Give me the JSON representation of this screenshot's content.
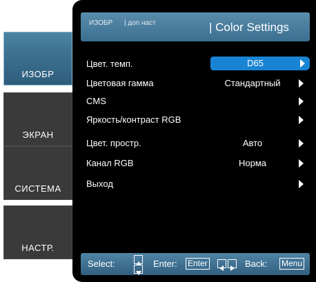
{
  "nav": {
    "items": [
      {
        "label": "ИЗОБР",
        "active": true
      },
      {
        "label": "ЭКРАН",
        "active": false
      },
      {
        "label": "СИСТЕМА",
        "active": false
      },
      {
        "label": "НАСТР.",
        "active": false
      }
    ]
  },
  "header": {
    "crumb1": "ИЗОБР",
    "crumb2": "| доп наст",
    "title": "| Color Settings"
  },
  "menu": {
    "rows": [
      {
        "label": "Цвет. темп.",
        "value": "D65",
        "selected": true,
        "arrow": true
      },
      {
        "label": "Цветовая гамма",
        "value": "Стандартный",
        "selected": false,
        "arrow": true
      },
      {
        "label": "CMS",
        "value": "",
        "selected": false,
        "arrow": true
      },
      {
        "label": "Яркость/контраст RGB",
        "value": "",
        "selected": false,
        "arrow": true
      },
      {
        "label": "Цвет. простр.",
        "value": "Авто",
        "selected": false,
        "arrow": true
      },
      {
        "label": "Канал RGB",
        "value": "Норма",
        "selected": false,
        "arrow": true
      },
      {
        "label": "Выход",
        "value": "",
        "selected": false,
        "arrow": true
      }
    ]
  },
  "footer": {
    "select_label": "Select:",
    "enter_label": "Enter:",
    "enter_key": "Enter",
    "back_label": "Back:",
    "menu_key": "Menu"
  },
  "colors": {
    "accent": "#1a84d4",
    "header_blue": "#4a7fa0",
    "panel_bg": "#000000",
    "nav_inactive": "#3a3a3a"
  }
}
